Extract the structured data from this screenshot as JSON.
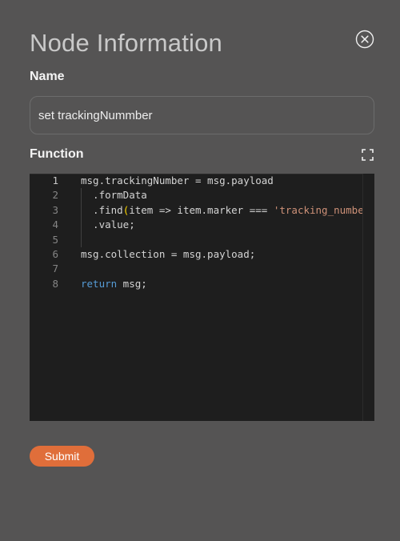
{
  "dialog": {
    "title": "Node Information",
    "close_icon": "close-circle-icon"
  },
  "name_field": {
    "label": "Name",
    "value": "set trackingNummber"
  },
  "function_field": {
    "label": "Function",
    "expand_icon": "fullscreen-icon"
  },
  "editor": {
    "line_numbers": [
      "1",
      "2",
      "3",
      "4",
      "5",
      "6",
      "7",
      "8"
    ],
    "active_line": "1",
    "lines": [
      [
        "msg.trackingNumber = msg.payload"
      ],
      [
        "  .formData"
      ],
      [
        "  .find",
        "(",
        "item => item.marker === ",
        "'tracking_number'",
        ")"
      ],
      [
        "  .value;"
      ],
      [
        ""
      ],
      [
        "msg.collection = msg.payload;"
      ],
      [
        ""
      ],
      [
        "return",
        " msg;"
      ]
    ]
  },
  "submit_label": "Submit",
  "colors": {
    "background": "#555454",
    "editor_background": "#1e1e1e",
    "accent": "#e06e3a",
    "keyword": "#569cd6",
    "string": "#ce9178",
    "bracket": "#ffd700"
  }
}
